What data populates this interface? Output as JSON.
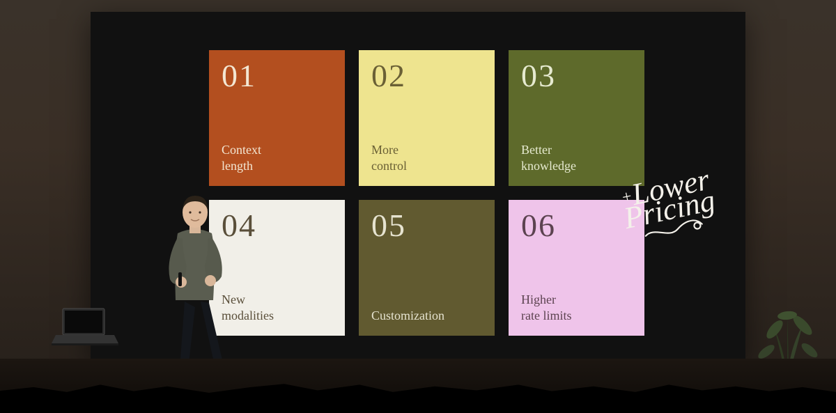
{
  "slide": {
    "tiles": [
      {
        "num": "01",
        "label": "Context\nlength",
        "bg": "#b34f1f"
      },
      {
        "num": "02",
        "label": "More\ncontrol",
        "bg": "#eee48f"
      },
      {
        "num": "03",
        "label": "Better\nknowledge",
        "bg": "#5e6a2b"
      },
      {
        "num": "04",
        "label": "New\nmodalities",
        "bg": "#f1efe8"
      },
      {
        "num": "05",
        "label": "Customization",
        "bg": "#615a30"
      },
      {
        "num": "06",
        "label": "Higher\nrate limits",
        "bg": "#efc4ea"
      }
    ],
    "badge": {
      "plus": "+",
      "line1": "Lower",
      "line2": "Pricing"
    }
  }
}
